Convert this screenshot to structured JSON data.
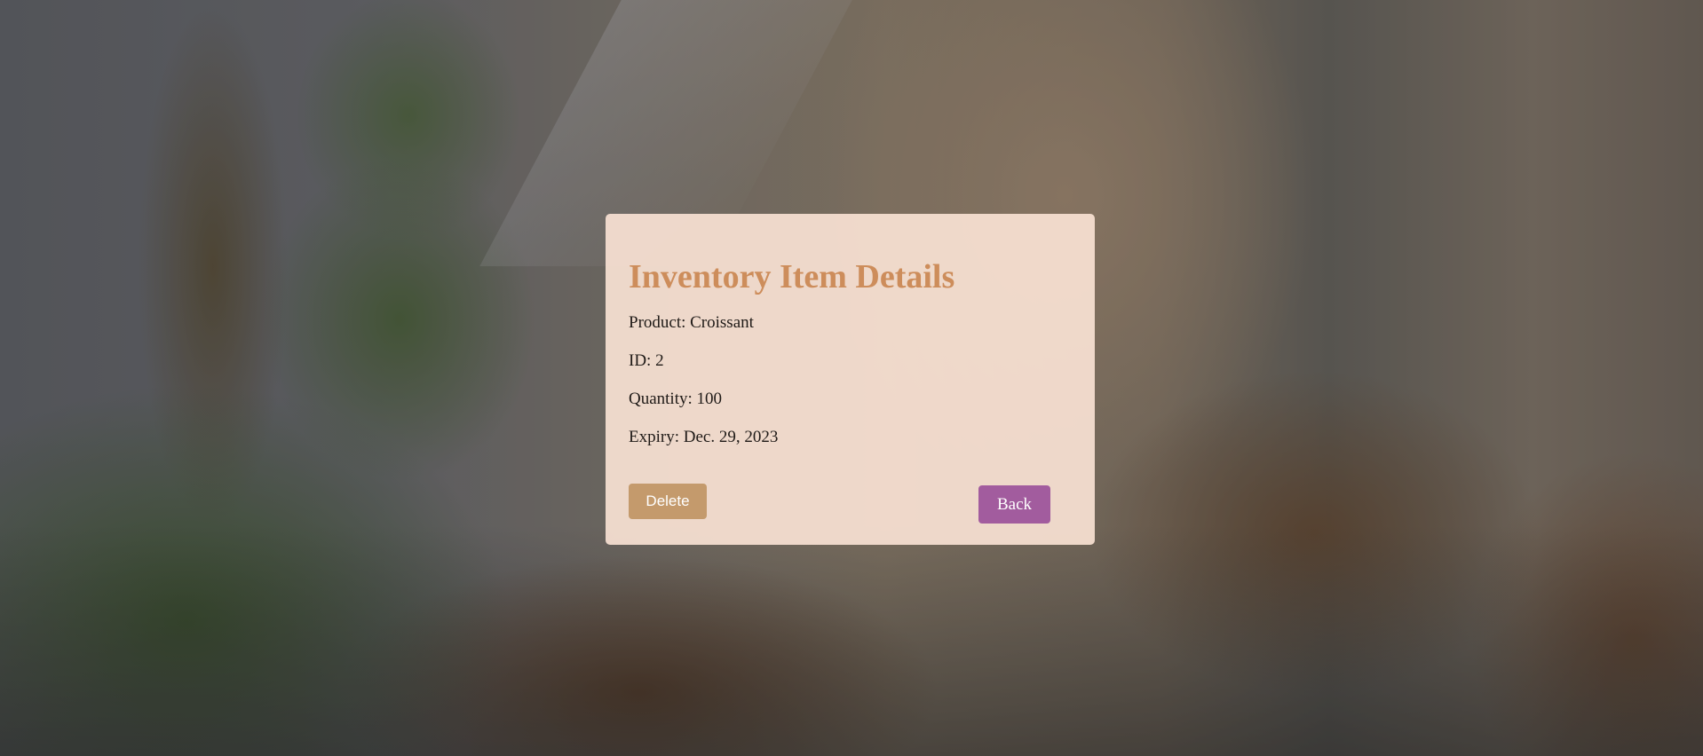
{
  "page": {
    "title": "Inventory Item Details"
  },
  "item": {
    "product_line": "Product: Croissant",
    "id_line": "ID: 2",
    "quantity_line": "Quantity: 100",
    "expiry_line": "Expiry: Dec. 29, 2023"
  },
  "actions": {
    "delete_label": "Delete",
    "back_label": "Back"
  },
  "colors": {
    "title": "#cd8d5b",
    "card_background": "#fce4d6",
    "delete_button": "#c49a6c",
    "back_button": "#a25c9e",
    "button_text": "#ffffff"
  }
}
